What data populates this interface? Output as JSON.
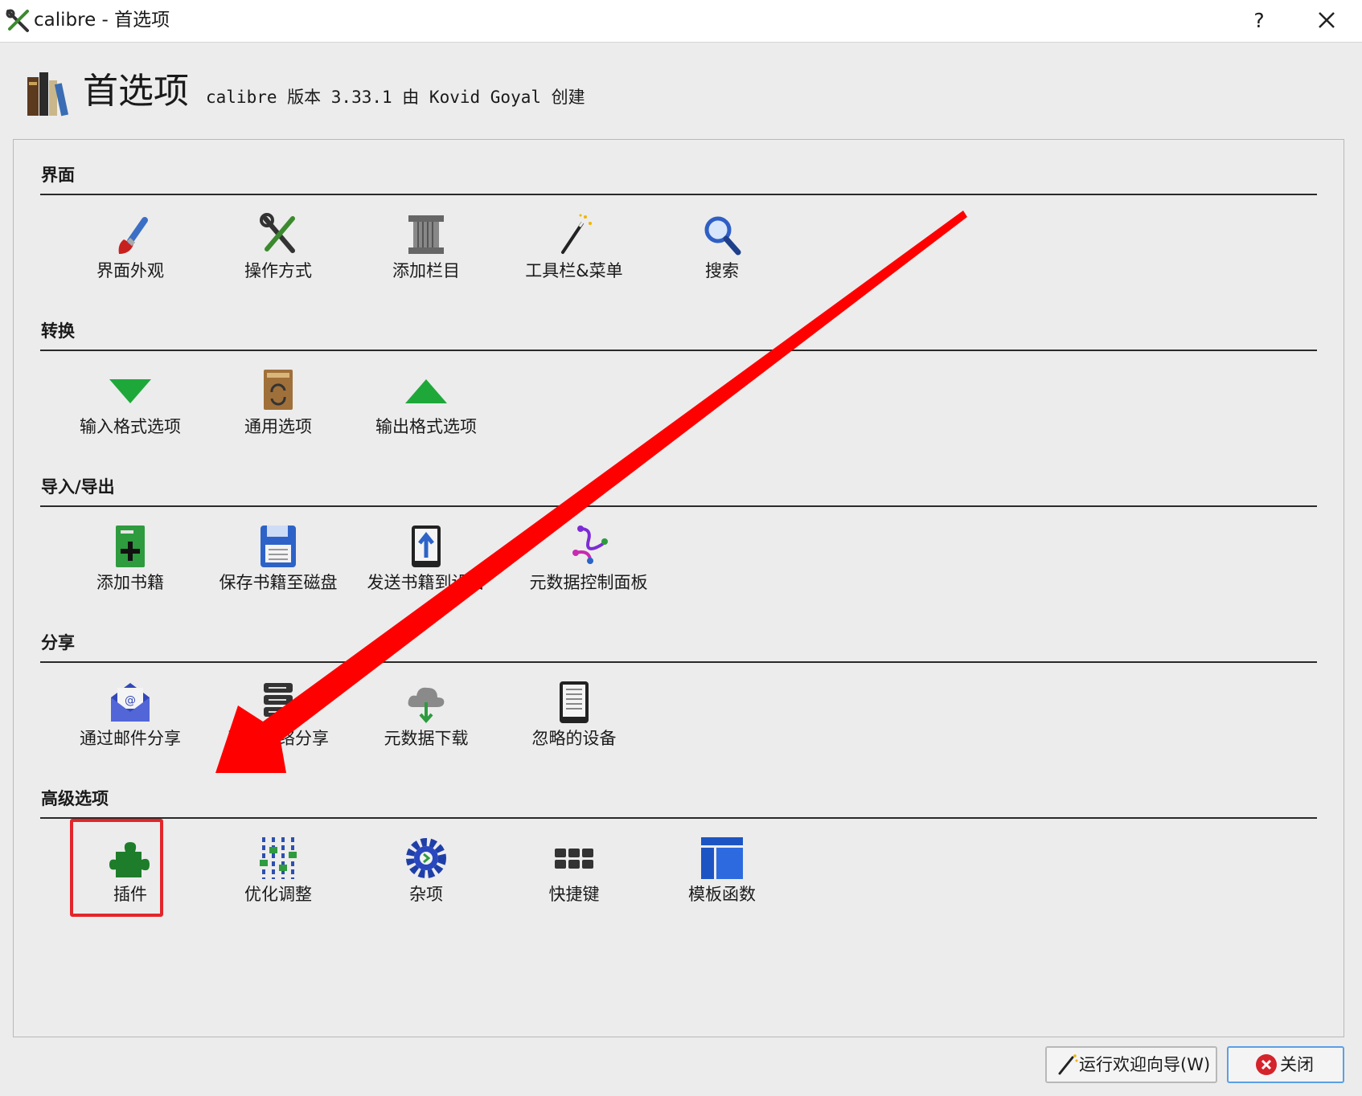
{
  "window": {
    "title": "calibre - 首选项",
    "help_label": "?"
  },
  "header": {
    "title": "首选项",
    "subtitle": "calibre 版本 3.33.1 由 Kovid Goyal 创建"
  },
  "sections": [
    {
      "title": "界面",
      "items": [
        {
          "label": "界面外观",
          "icon": "paintbrush-icon"
        },
        {
          "label": "操作方式",
          "icon": "tools-icon"
        },
        {
          "label": "添加栏目",
          "icon": "column-icon"
        },
        {
          "label": "工具栏&菜单",
          "icon": "magic-wand-icon"
        },
        {
          "label": "搜索",
          "icon": "search-icon"
        }
      ]
    },
    {
      "title": "转换",
      "items": [
        {
          "label": "输入格式选项",
          "icon": "arrow-down-icon"
        },
        {
          "label": "通用选项",
          "icon": "book-convert-icon"
        },
        {
          "label": "输出格式选项",
          "icon": "arrow-up-icon"
        }
      ]
    },
    {
      "title": "导入/导出",
      "items": [
        {
          "label": "添加书籍",
          "icon": "add-book-icon"
        },
        {
          "label": "保存书籍至磁盘",
          "icon": "floppy-disk-icon"
        },
        {
          "label": "发送书籍到设备",
          "icon": "send-to-device-icon"
        },
        {
          "label": "元数据控制面板",
          "icon": "metadata-plugboard-icon"
        }
      ]
    },
    {
      "title": "分享",
      "items": [
        {
          "label": "通过邮件分享",
          "icon": "email-icon"
        },
        {
          "label": "通过网络分享",
          "icon": "server-icon"
        },
        {
          "label": "元数据下载",
          "icon": "cloud-download-icon"
        },
        {
          "label": "忽略的设备",
          "icon": "ereader-icon"
        }
      ]
    },
    {
      "title": "高级选项",
      "items": [
        {
          "label": "插件",
          "icon": "puzzle-plugin-icon"
        },
        {
          "label": "优化调整",
          "icon": "sliders-icon"
        },
        {
          "label": "杂项",
          "icon": "gear-icon"
        },
        {
          "label": "快捷键",
          "icon": "keyboard-icon"
        },
        {
          "label": "模板函数",
          "icon": "template-icon"
        }
      ]
    }
  ],
  "buttons": {
    "wizard": "运行欢迎向导(W)",
    "close": "关闭"
  },
  "colors": {
    "highlight": "#e3262b",
    "arrow": "#ff0000",
    "close_button_border": "#5aa0e6"
  }
}
